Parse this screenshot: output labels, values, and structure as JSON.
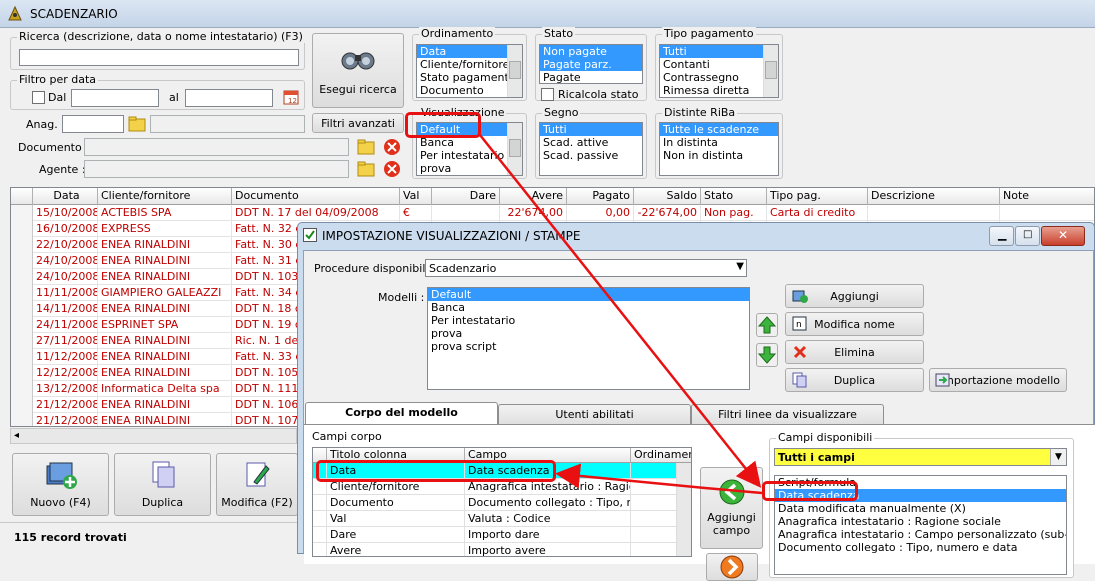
{
  "app": {
    "title": "SCADENZARIO",
    "main_buttons": [
      "Nuovo (F4)",
      "Duplica",
      "Modifica (F2)"
    ],
    "record_count": "115 record trovati"
  },
  "filters": {
    "search_label": "Ricerca (descrizione, data o nome intestatario) (F3)",
    "date_filter_label": "Filtro per data",
    "dal_label": "Dal",
    "al_label": "al",
    "anag_label": "Anag. :",
    "documento_label": "Documento :",
    "agente_label": "Agente :",
    "search_button": "Esegui ricerca",
    "advanced_button": "Filtri avanzati"
  },
  "groups": {
    "ordinamento": {
      "label": "Ordinamento",
      "items": [
        "Data",
        "Cliente/fornitore",
        "Stato pagamento",
        "Documento"
      ]
    },
    "stato": {
      "label": "Stato",
      "items": [
        "Non pagate",
        "Pagate parz.",
        "Pagate"
      ],
      "ricalcola": "Ricalcola stato"
    },
    "tipo_pagamento": {
      "label": "Tipo pagamento",
      "items": [
        "Tutti",
        "Contanti",
        "Contrassegno",
        "Rimessa diretta"
      ]
    },
    "visualizzazione": {
      "label": "Visualizzazione",
      "items": [
        "Default",
        "Banca",
        "Per intestatario",
        "prova"
      ]
    },
    "segno": {
      "label": "Segno",
      "items": [
        "Tutti",
        "Scad. attive",
        "Scad. passive"
      ]
    },
    "distinte": {
      "label": "Distinte RiBa",
      "items": [
        "Tutte le scadenze",
        "In distinta",
        "Non in distinta"
      ]
    }
  },
  "grid": {
    "columns": [
      "Data",
      "Cliente/fornitore",
      "Documento",
      "Val",
      "Dare",
      "Avere",
      "Pagato",
      "Saldo",
      "Stato",
      "Tipo pag.",
      "Descrizione",
      "Note"
    ],
    "rows": [
      {
        "data": "15/10/2008",
        "cliente": "ACTEBIS SPA",
        "documento": "DDT N. 17 del 04/09/2008",
        "val": "€",
        "dare": "",
        "avere": "22'674,00",
        "pagato": "0,00",
        "saldo": "-22'674,00",
        "stato": "Non pag.",
        "tipo": "Carta di credito"
      },
      {
        "data": "16/10/2008",
        "cliente": "EXPRESS",
        "documento": "Fatt. N. 32 c"
      },
      {
        "data": "22/10/2008",
        "cliente": "ENEA RINALDINI",
        "documento": "Fatt. N. 30 c"
      },
      {
        "data": "24/10/2008",
        "cliente": "ENEA RINALDINI",
        "documento": "Fatt. N. 31 c"
      },
      {
        "data": "24/10/2008",
        "cliente": "ENEA RINALDINI",
        "documento": "DDT N. 103"
      },
      {
        "data": "11/11/2008",
        "cliente": "GIAMPIERO GALEAZZI",
        "documento": "Fatt. N. 34 c"
      },
      {
        "data": "14/11/2008",
        "cliente": "ENEA RINALDINI",
        "documento": "DDT N. 18 c"
      },
      {
        "data": "24/11/2008",
        "cliente": "ESPRINET SPA",
        "documento": "DDT N. 19 c"
      },
      {
        "data": "27/11/2008",
        "cliente": "ENEA RINALDINI",
        "documento": "Ric. N. 1 de"
      },
      {
        "data": "11/12/2008",
        "cliente": "ENEA RINALDINI",
        "documento": "Fatt. N. 33 c"
      },
      {
        "data": "12/12/2008",
        "cliente": "ENEA RINALDINI",
        "documento": "DDT N. 105"
      },
      {
        "data": "13/12/2008",
        "cliente": "Informatica Delta spa",
        "documento": "DDT N. 111"
      },
      {
        "data": "21/12/2008",
        "cliente": "ENEA RINALDINI",
        "documento": "DDT N. 106"
      },
      {
        "data": "21/12/2008",
        "cliente": "ENEA RINALDINI",
        "documento": "DDT N. 107"
      }
    ]
  },
  "dialog": {
    "title": "IMPOSTAZIONE VISUALIZZAZIONI / STAMPE",
    "procedure_label": "Procedure disponibili :",
    "procedure_value": "Scadenzario",
    "modelli_label": "Modelli :",
    "modelli": [
      "Default",
      "Banca",
      "Per intestatario",
      "prova",
      "prova script"
    ],
    "buttons": {
      "aggiungi": "Aggiungi",
      "modifica": "Modifica nome",
      "elimina": "Elimina",
      "duplica": "Duplica",
      "importa": "Importazione modello"
    },
    "tabs": [
      "Corpo del modello",
      "Utenti abilitati",
      "Filtri linee da visualizzare"
    ],
    "campi_corpo_label": "Campi corpo",
    "corpo_columns": [
      "Titolo colonna",
      "Campo",
      "Ordinamen"
    ],
    "corpo_rows": [
      {
        "titolo": "Data",
        "campo": "Data scadenza"
      },
      {
        "titolo": "Cliente/fornitore",
        "campo": "Anagrafica intestatario : Ragion..."
      },
      {
        "titolo": "Documento",
        "campo": "Documento collegato : Tipo, nu..."
      },
      {
        "titolo": "Val",
        "campo": "Valuta : Codice"
      },
      {
        "titolo": "Dare",
        "campo": "Importo dare"
      },
      {
        "titolo": "Avere",
        "campo": "Importo avere"
      }
    ],
    "aggiungi_campo": "Aggiungi campo",
    "campi_disponibili_label": "Campi disponibili",
    "campi_filter": "Tutti i campi",
    "campi_disponibili": [
      "Script/formula",
      "Data scadenza",
      "Data modificata manualmente (X)",
      "Anagrafica intestatario : Ragione sociale",
      "Anagrafica intestatario : Campo personalizzato (sub-opzion",
      "Documento collegato : Tipo, numero e data"
    ]
  },
  "colors": {
    "selection": "#3399ff",
    "highlight_row": "#00ffff",
    "annotation": "#e81010",
    "row_text": "#c00000"
  }
}
